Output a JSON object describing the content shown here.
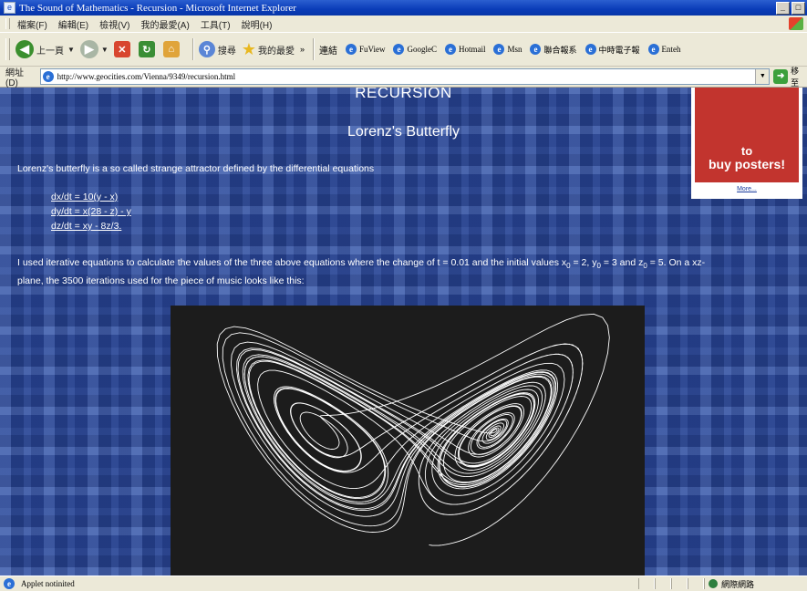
{
  "window": {
    "title": "The Sound of Mathematics - Recursion - Microsoft Internet Explorer",
    "controls": {
      "minimize": "_",
      "maximize": "□"
    }
  },
  "menu": {
    "items": [
      "檔案(F)",
      "編輯(E)",
      "檢視(V)",
      "我的最愛(A)",
      "工具(T)",
      "說明(H)"
    ]
  },
  "toolbar": {
    "back_label": "上一頁",
    "search_label": "搜尋",
    "favorites_label": "我的最愛",
    "links_label": "連結",
    "links": [
      "FuView",
      "GoogleC",
      "Hotmail",
      "Msn",
      "聯合報系",
      "中時電子報",
      "Enteh"
    ]
  },
  "address": {
    "label": "網址(D)",
    "url": "http://www.geocities.com/Vienna/9349/recursion.html",
    "go_label": "移至"
  },
  "page": {
    "heading": "RECURSION",
    "subheading": "Lorenz's Butterfly",
    "intro": "Lorenz's butterfly is a so called strange attractor defined by the differential equations",
    "equations": [
      "dx/dt = 10(y - x)",
      "dy/dt = x(28 - z) - y",
      "dz/dt = xy - 8z/3."
    ],
    "body_before_x": "I used iterative equations to calculate the values of the three above equations where the change of t = 0.01 and the initial values x",
    "x0": "= 2, y",
    "y0": "= 3 and z",
    "z0": "= 5. On a xz-",
    "sub_zero": "0",
    "body_line2": "plane, the 3500 iterations used for the piece of music looks like this:"
  },
  "ad": {
    "line1": "to",
    "line2": "buy posters!",
    "more_link": "More..."
  },
  "applet": {
    "description_title": "",
    "colors": {
      "background": "#1c1c1c",
      "trace": "#ffffff"
    }
  },
  "status": {
    "text": "Applet notinited",
    "zone": "網際網路"
  },
  "colors": {
    "title_bar": "#0a3cb8",
    "page_bg": "#304a92",
    "ad_red": "#c2342e"
  }
}
